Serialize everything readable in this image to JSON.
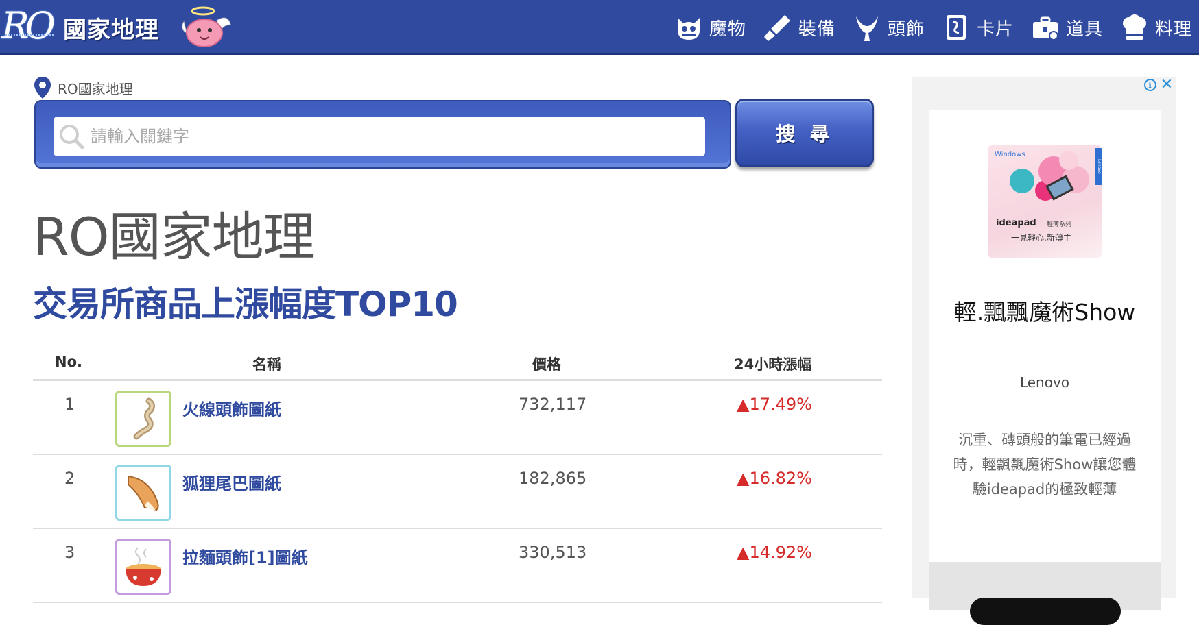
{
  "header": {
    "logo_ro": "RO",
    "logo_text": "國家地理",
    "nav": [
      {
        "id": "monster",
        "label": "魔物",
        "icon": "monster-face-icon"
      },
      {
        "id": "equipment",
        "label": "裝備",
        "icon": "sword-icon"
      },
      {
        "id": "headgear",
        "label": "頭飾",
        "icon": "horns-icon"
      },
      {
        "id": "card",
        "label": "卡片",
        "icon": "card-icon"
      },
      {
        "id": "item",
        "label": "道具",
        "icon": "toolbox-icon"
      },
      {
        "id": "cooking",
        "label": "料理",
        "icon": "chef-hat-icon"
      }
    ]
  },
  "breadcrumb": {
    "label": "RO國家地理",
    "icon": "map-pin-icon"
  },
  "search": {
    "placeholder": "請輸入關鍵字",
    "value": "",
    "button_label": "搜 尋",
    "icon": "search-icon"
  },
  "page_title": "RO國家地理",
  "section_title": "交易所商品上漲幅度TOP10",
  "table": {
    "headers": {
      "no": "No.",
      "name": "名稱",
      "price": "價格",
      "change": "24小時漲幅"
    },
    "rows": [
      {
        "no": "1",
        "name": "火線頭飾圖紙",
        "price": "732,117",
        "change": "▲17.49%",
        "border_color": "#b7d77a",
        "icon": "rope-item-icon"
      },
      {
        "no": "2",
        "name": "狐狸尾巴圖紙",
        "price": "182,865",
        "change": "▲16.82%",
        "border_color": "#8fd6e6",
        "icon": "fox-tail-icon"
      },
      {
        "no": "3",
        "name": "拉麵頭飾[1]圖紙",
        "price": "330,513",
        "change": "▲14.92%",
        "border_color": "#c39be0",
        "icon": "ramen-bowl-icon"
      }
    ]
  },
  "ad": {
    "image_text": {
      "windows": "Windows",
      "brand": "ideapad",
      "brand_sub": "輕薄系列",
      "tagline": "一見輕心,新薄主",
      "strip": "Lenovo"
    },
    "headline": "輕.飄飄魔術Show",
    "advertiser": "Lenovo",
    "body": "沉重、磚頭般的筆電已經過時，輕飄飄魔術Show讓您體驗ideapad的極致輕薄"
  },
  "colors": {
    "brand_blue": "#2f4a9e",
    "rise_red": "#d62b2b",
    "header_bg": "#2f4a9e"
  }
}
